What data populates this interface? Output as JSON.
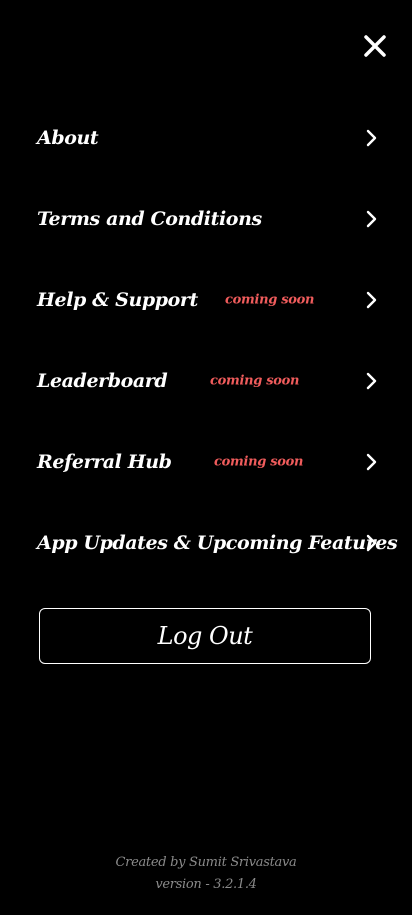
{
  "colors": {
    "background": "#000000",
    "text": "#ffffff",
    "coming_soon": "#f05c5c",
    "footer_text": "#8a8a8a"
  },
  "close_icon": "close-icon",
  "menu": {
    "items": [
      {
        "label": "About",
        "coming_soon": "",
        "icon": "chevron-right-icon"
      },
      {
        "label": "Terms and Conditions",
        "coming_soon": "",
        "icon": "chevron-right-icon"
      },
      {
        "label": "Help & Support",
        "coming_soon": "coming soon",
        "icon": "chevron-right-icon"
      },
      {
        "label": "Leaderboard",
        "coming_soon": "coming soon",
        "icon": "chevron-right-icon"
      },
      {
        "label": "Referral Hub",
        "coming_soon": "coming soon",
        "icon": "chevron-right-icon"
      },
      {
        "label": "App Updates & Upcoming Features",
        "coming_soon": "",
        "icon": "chevron-right-icon"
      }
    ]
  },
  "logout": {
    "label": "Log Out"
  },
  "footer": {
    "credit": "Created by Sumit Srivastava",
    "version": "version - 3.2.1.4"
  }
}
